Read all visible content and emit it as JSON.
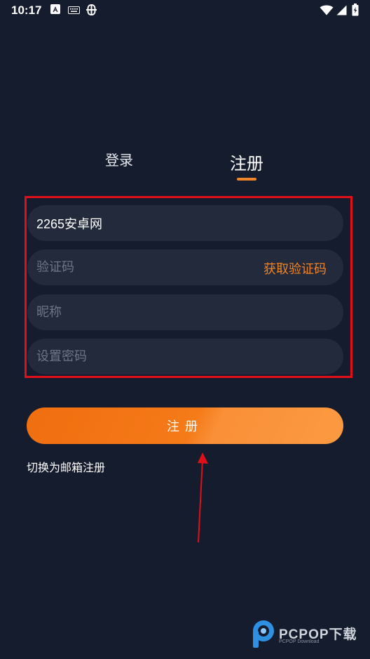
{
  "status_bar": {
    "time": "10:17",
    "icons": [
      "accessibility-a-icon",
      "keyboard-icon",
      "bug-icon",
      "wifi-icon",
      "signal-icon",
      "battery-icon"
    ]
  },
  "tabs": [
    {
      "label": "登录",
      "selected": false
    },
    {
      "label": "注册",
      "selected": true
    }
  ],
  "form": {
    "phone_value": "2265安卓网",
    "code_placeholder": "验证码",
    "get_code_label": "获取验证码",
    "nickname_placeholder": "昵称",
    "password_placeholder": "设置密码"
  },
  "register_button_label": "注册",
  "switch_link_label": "切换为邮箱注册",
  "watermark": {
    "text": "PCPOP下载",
    "subtext": "PCPOP Download"
  },
  "colors": {
    "background": "#151c2d",
    "field": "#222a3b",
    "accent": "#f08426",
    "highlight": "#e0101b"
  }
}
